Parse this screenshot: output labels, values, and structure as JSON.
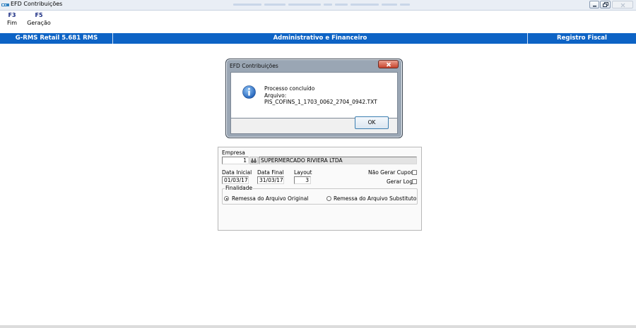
{
  "window": {
    "title": "EFD Contribuições",
    "icon": "rms-app-icon",
    "controls": [
      "minimize-icon",
      "restore-icon",
      "close-icon"
    ]
  },
  "toolbar": {
    "items": [
      {
        "key": "F3",
        "label": "Fim"
      },
      {
        "key": "F5",
        "label": "Geração"
      }
    ]
  },
  "header": {
    "left": "G-RMS Retail 5.681 RMS",
    "center": "Administrativo e Financeiro",
    "right": "Registro Fiscal",
    "color": "#0d63c5"
  },
  "dialog": {
    "title": "EFD Contribuições",
    "icon": "info-icon",
    "message_line1": "Processo concluído",
    "message_line2": "Arquivo: PIS_COFINS_1_1703_0062_2704_0942.TXT",
    "ok_label": "OK"
  },
  "form": {
    "empresa_label": "Empresa",
    "empresa_code": "1",
    "empresa_name": "SUPERMERCADO RIVIERA LTDA",
    "data_inicial_label": "Data Inicial",
    "data_inicial": "01/03/17",
    "data_final_label": "Data Final",
    "data_final": "31/03/17",
    "layout_label": "Layout",
    "layout": "3",
    "nao_gerar_cupons_label": "Não Gerar Cupons",
    "nao_gerar_cupons": false,
    "gerar_log_label": "Gerar Log",
    "gerar_log": false,
    "finalidade_label": "Finalidade",
    "finalidade_options": [
      "Remessa do Arquivo Original",
      "Remessa do Arquivo Substituto"
    ],
    "finalidade_selected": "Remessa do Arquivo Original"
  }
}
